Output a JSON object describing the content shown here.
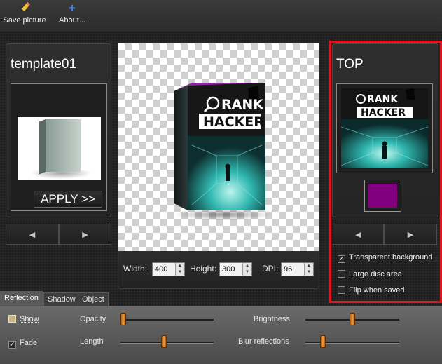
{
  "toolbar": {
    "save_label": "Save picture",
    "about_label": "About..."
  },
  "left_panel": {
    "title": "template01",
    "apply_label": "APPLY >>"
  },
  "right_panel": {
    "title": "TOP",
    "color_swatch": "#800080",
    "options": [
      {
        "label": "Transparent background",
        "checked": true
      },
      {
        "label": "Large disc area",
        "checked": false
      },
      {
        "label": "Flip when saved",
        "checked": false
      }
    ]
  },
  "box_art": {
    "brand_line1": "RANK",
    "brand_line2": "HACKER"
  },
  "size": {
    "width_label": "Width:",
    "width_value": "400",
    "height_label": "Height:",
    "height_value": "300",
    "dpi_label": "DPI:",
    "dpi_value": "96"
  },
  "tabs": [
    "Reflection",
    "Shadow",
    "Object"
  ],
  "active_tab": "Reflection",
  "reflection": {
    "show_label": "Show",
    "show_checked": false,
    "fade_label": "Fade",
    "fade_checked": true,
    "opacity_label": "Opacity",
    "opacity_level": 0.0,
    "length_label": "Length",
    "length_level": 0.46,
    "brightness_label": "Brightness",
    "brightness_level": 0.5,
    "blur_label": "Blur reflections",
    "blur_level": 0.17
  },
  "colors": {
    "accent_red": "#e0141c",
    "slider_thumb": "#e8932e",
    "teal": "#2fb8b0"
  }
}
